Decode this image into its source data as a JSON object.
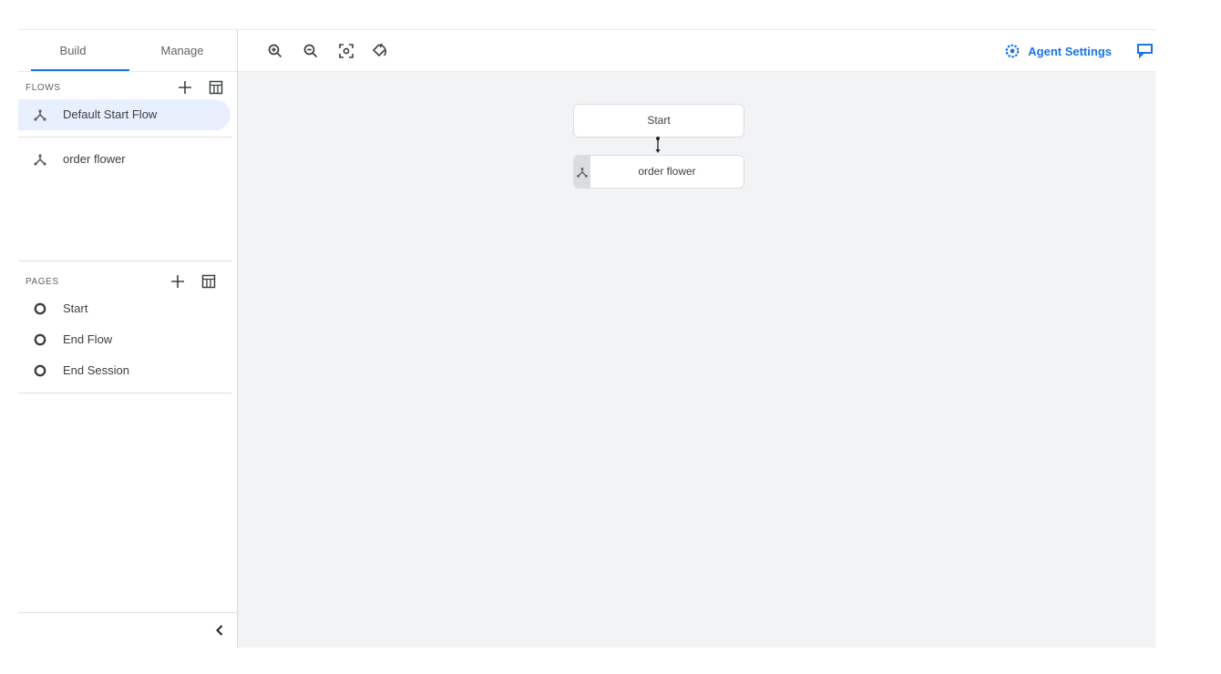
{
  "tabs": {
    "build": "Build",
    "manage": "Manage"
  },
  "flows": {
    "label": "FLOWS",
    "items": [
      {
        "label": "Default Start Flow",
        "active": true
      },
      {
        "label": "order flower",
        "active": false
      }
    ]
  },
  "pages": {
    "label": "PAGES",
    "items": [
      {
        "label": "Start"
      },
      {
        "label": "End Flow"
      },
      {
        "label": "End Session"
      }
    ]
  },
  "toolbar": {
    "agent_settings": "Agent Settings"
  },
  "canvas": {
    "start_node": "Start",
    "flow_node": "order flower"
  },
  "colors": {
    "accent": "#1a73e8",
    "active_bg": "#e8f0fe",
    "canvas_bg": "#f1f3f4"
  },
  "icons": [
    "flow-icon",
    "page-circle-icon",
    "add-icon",
    "table-icon",
    "zoom-in-icon",
    "zoom-out-icon",
    "fit-screen-icon",
    "reset-rotate-icon",
    "gear-icon",
    "chat-icon",
    "chevron-left-icon"
  ]
}
